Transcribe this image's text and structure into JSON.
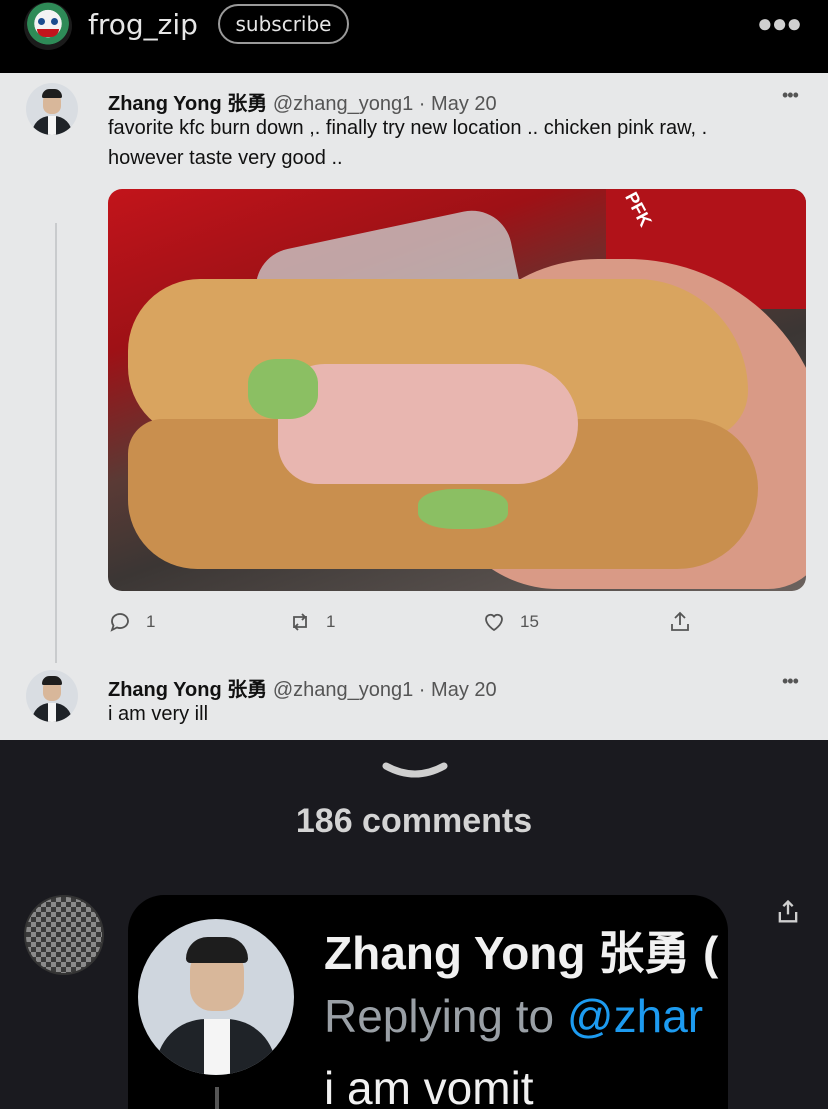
{
  "header": {
    "username": "frog_zip",
    "subscribe_label": "subscribe",
    "more_icon": "more-horizontal-icon"
  },
  "tweet": {
    "display_name": "Zhang Yong 张勇",
    "handle": "@zhang_yong1",
    "separator": "·",
    "date": "May 20",
    "text": "favorite kfc burn down ,. finally try new location .. chicken  pink raw, . however taste very good ..",
    "photo_label": "PFK",
    "replies": "1",
    "retweets": "1",
    "likes": "15"
  },
  "reply_tweet": {
    "display_name": "Zhang Yong 张勇",
    "handle": "@zhang_yong1",
    "separator": "·",
    "date": "May 20",
    "text": "i am very ill"
  },
  "comments": {
    "count_label": "186 comments"
  },
  "top_comment": {
    "image_name": "Zhang Yong 张勇 (",
    "image_replying_prefix": "Replying to ",
    "image_replying_mention": "@zhar",
    "image_text": "i am vomit"
  }
}
